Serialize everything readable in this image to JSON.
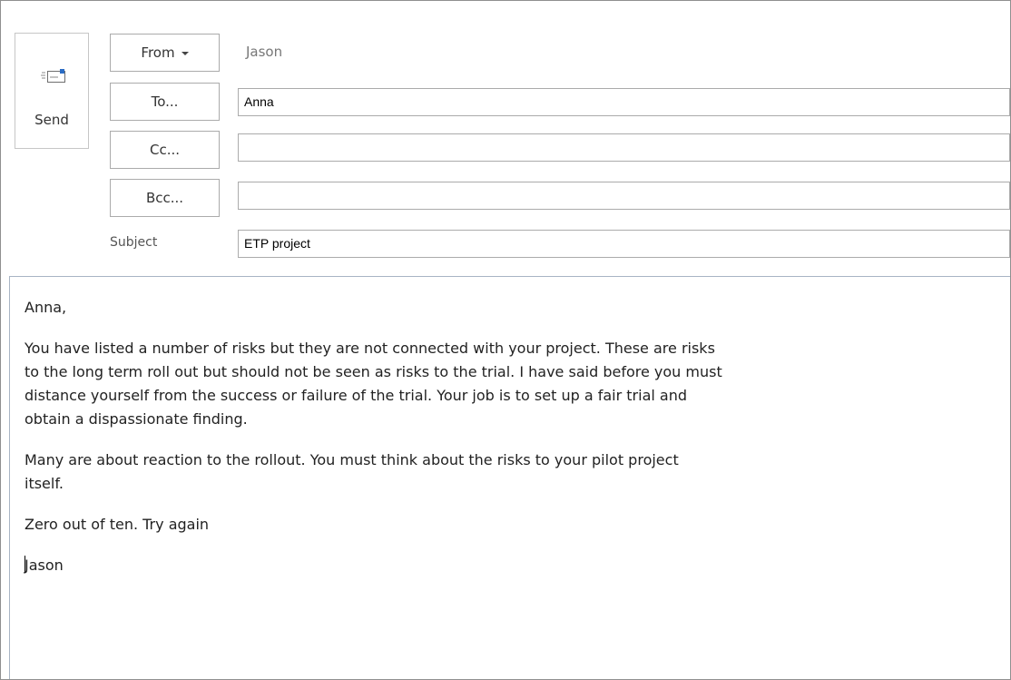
{
  "send": {
    "label": "Send",
    "icon": "send-mail-icon"
  },
  "fields": {
    "from_label": "From",
    "from_value": "Jason",
    "to_label": "To...",
    "to_value": "Anna",
    "cc_label": "Cc...",
    "cc_value": "",
    "bcc_label": "Bcc...",
    "bcc_value": "",
    "subject_label": "Subject",
    "subject_value": "ETP project"
  },
  "body": {
    "greeting": "Anna,",
    "paragraph1": "You have listed a number of risks but they are not connected with your project. These are risks\nto the long term roll out but should not be seen as risks to the trial. I have said before you must\ndistance yourself from the success or failure of the trial. Your job is to set up a fair trial and\nobtain a dispassionate finding.",
    "paragraph2": "Many are about reaction to the rollout. You must think about the risks to your pilot project\nitself.",
    "paragraph3": "Zero out of ten. Try again",
    "signature": "Jason"
  },
  "colors": {
    "border": "#ababab",
    "body_border": "#a8b4c4",
    "icon_accent": "#2b6cc4"
  }
}
